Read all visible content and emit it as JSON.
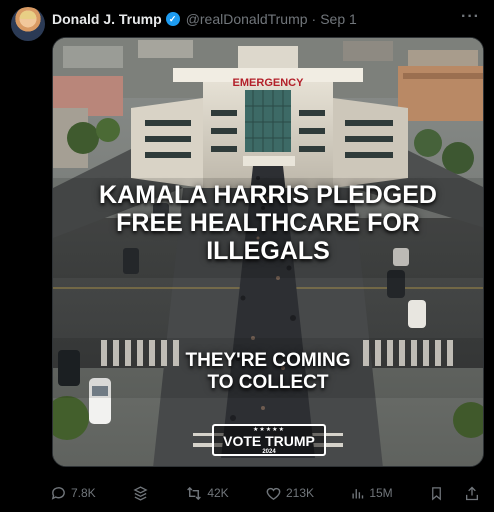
{
  "post": {
    "display_name": "Donald J. Trump",
    "handle": "@realDonaldTrump",
    "separator": "·",
    "date": "Sep 1",
    "verified_mark": "✓",
    "more_glyph": "···"
  },
  "image": {
    "building_sign": "EMERGENCY",
    "headline": "KAMALA HARRIS PLEDGED FREE HEALTHCARE FOR ILLEGALS",
    "subline_1": "THEY'RE COMING",
    "subline_2": "TO COLLECT",
    "badge_stars": "★★★★★",
    "badge_text": "VOTE TRUMP",
    "badge_year": "2024"
  },
  "actions": {
    "replies": "7.8K",
    "reposts": "42K",
    "likes": "213K",
    "views": "15M"
  },
  "colors": {
    "background": "#000000",
    "text_primary": "#e7e9ea",
    "text_secondary": "#71767b",
    "verified_blue": "#1d9bf0",
    "sign_red": "#b3202a"
  },
  "icons": {
    "verified": "verified-badge-icon",
    "more": "more-options-icon",
    "reply": "reply-icon",
    "grok": "grok-icon",
    "repost": "repost-icon",
    "like": "heart-icon",
    "views": "views-icon",
    "bookmark": "bookmark-icon",
    "share": "share-icon"
  }
}
